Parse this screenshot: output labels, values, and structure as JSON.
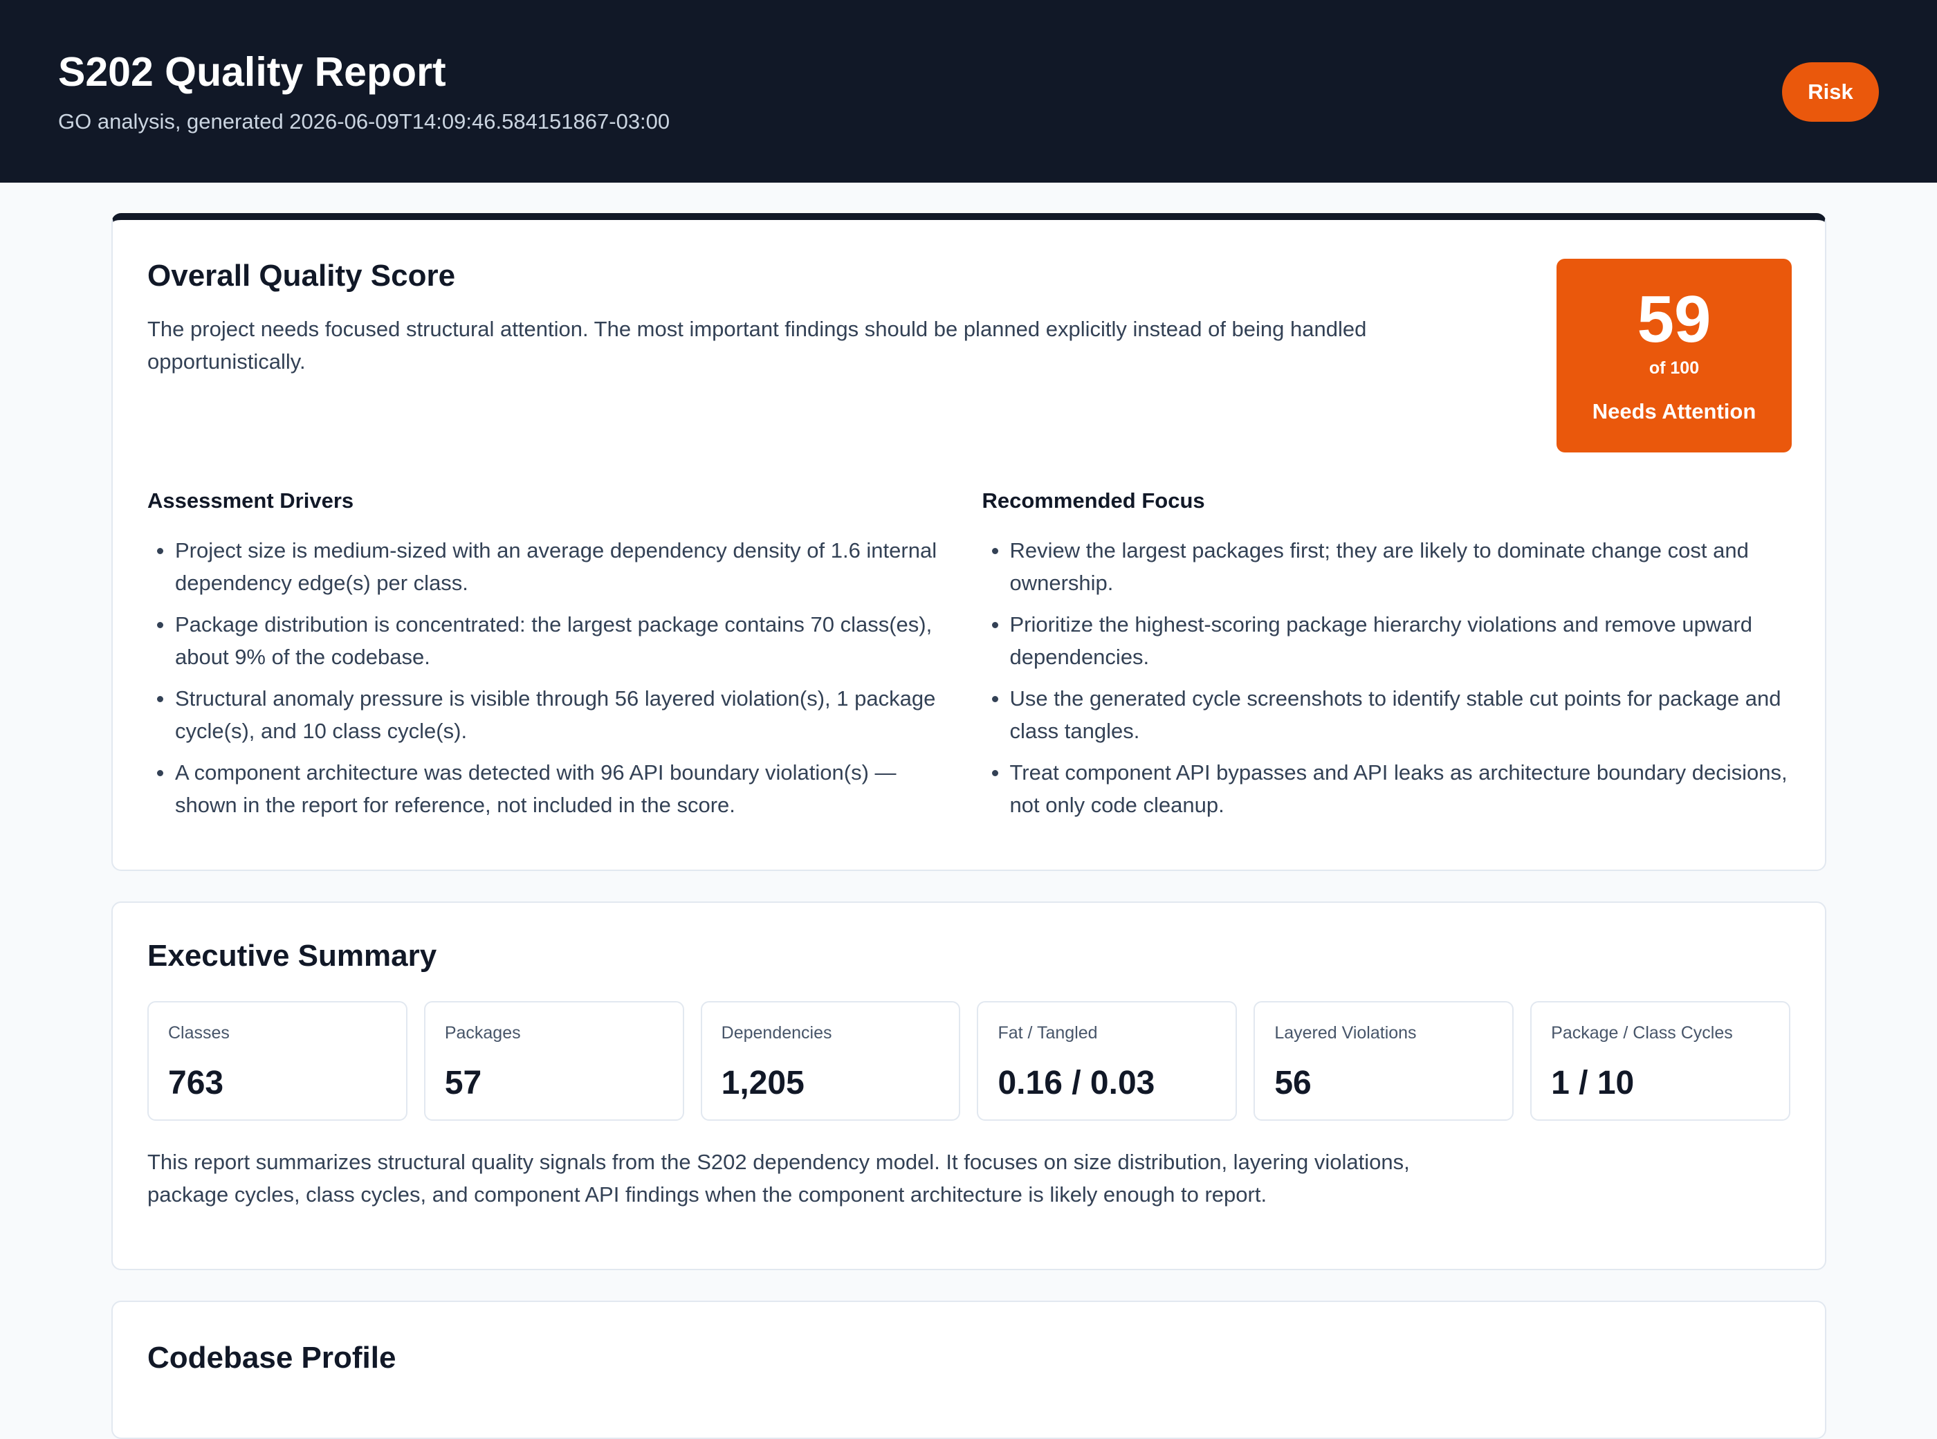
{
  "header": {
    "title": "S202 Quality Report",
    "subtitle": "GO analysis, generated 2026-06-09T14:09:46.584151867-03:00",
    "badge": "Risk"
  },
  "colors": {
    "header_bg": "#111827",
    "risk": "#ea580c",
    "page_bg": "#f8fafc"
  },
  "score": {
    "title": "Overall Quality Score",
    "intro": "The project needs focused structural attention. The most important findings should be planned explicitly instead of being handled opportunistically.",
    "value": "59",
    "of": "of 100",
    "label": "Needs Attention",
    "drivers": {
      "title": "Assessment Drivers",
      "items": [
        "Project size is medium-sized with an average dependency density of 1.6 internal dependency edge(s) per class.",
        "Package distribution is concentrated: the largest package contains 70 class(es), about 9% of the codebase.",
        "Structural anomaly pressure is visible through 56 layered violation(s), 1 package cycle(s), and 10 class cycle(s).",
        "A component architecture was detected with 96 API boundary violation(s) — shown in the report for reference, not included in the score."
      ]
    },
    "focus": {
      "title": "Recommended Focus",
      "items": [
        "Review the largest packages first; they are likely to dominate change cost and ownership.",
        "Prioritize the highest-scoring package hierarchy violations and remove upward dependencies.",
        "Use the generated cycle screenshots to identify stable cut points for package and class tangles.",
        "Treat component API bypasses and API leaks as architecture boundary decisions, not only code cleanup."
      ]
    }
  },
  "summary": {
    "title": "Executive Summary",
    "metrics": [
      {
        "label": "Classes",
        "value": "763"
      },
      {
        "label": "Packages",
        "value": "57"
      },
      {
        "label": "Dependencies",
        "value": "1,205"
      },
      {
        "label": "Fat / Tangled",
        "value": "0.16 / 0.03"
      },
      {
        "label": "Layered Violations",
        "value": "56"
      },
      {
        "label": "Package / Class Cycles",
        "value": "1 / 10"
      }
    ],
    "text": "This report summarizes structural quality signals from the S202 dependency model. It focuses on size distribution, layering violations, package cycles, class cycles, and component API findings when the component architecture is likely enough to report."
  },
  "profile": {
    "title": "Codebase Profile"
  }
}
